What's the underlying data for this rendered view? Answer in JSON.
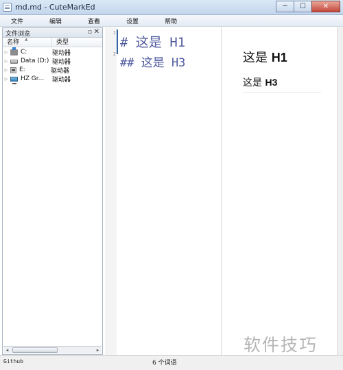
{
  "window": {
    "title": "md.md - CuteMarkEd",
    "minimize_glyph": "─",
    "maximize_glyph": "☐",
    "close_glyph": "✕"
  },
  "menu": {
    "items": [
      {
        "label": "文件"
      },
      {
        "label": "编辑"
      },
      {
        "label": "查看"
      },
      {
        "label": "设置"
      },
      {
        "label": "帮助"
      }
    ]
  },
  "file_browser": {
    "title": "文件浏览",
    "float_glyph": "▫",
    "close_glyph": "✕",
    "columns": {
      "name": "名称",
      "type": "类型"
    },
    "drives": [
      {
        "name": "C:",
        "type": "驱动器",
        "icon": "system-drive-icon"
      },
      {
        "name": "Data (D:)",
        "type": "驱动器",
        "icon": "hard-drive-icon"
      },
      {
        "name": "E:",
        "type": "驱动器",
        "icon": "removable-drive-icon"
      },
      {
        "name": "HZ Gr...",
        "type": "驱动器",
        "icon": "network-drive-icon"
      }
    ],
    "scroll_left": "◂",
    "scroll_right": "▸"
  },
  "editor": {
    "lines": [
      {
        "number": "1",
        "text": "# 这是 H1"
      },
      {
        "number": "2",
        "text": "## 这是 H3"
      }
    ]
  },
  "preview": {
    "h1_prefix": "这是 ",
    "h1_bold": "H1",
    "h3_prefix": "这是 ",
    "h3_bold": "H3"
  },
  "status": {
    "left": "Github",
    "center": "6 个词语"
  },
  "watermark": "软件技巧"
}
